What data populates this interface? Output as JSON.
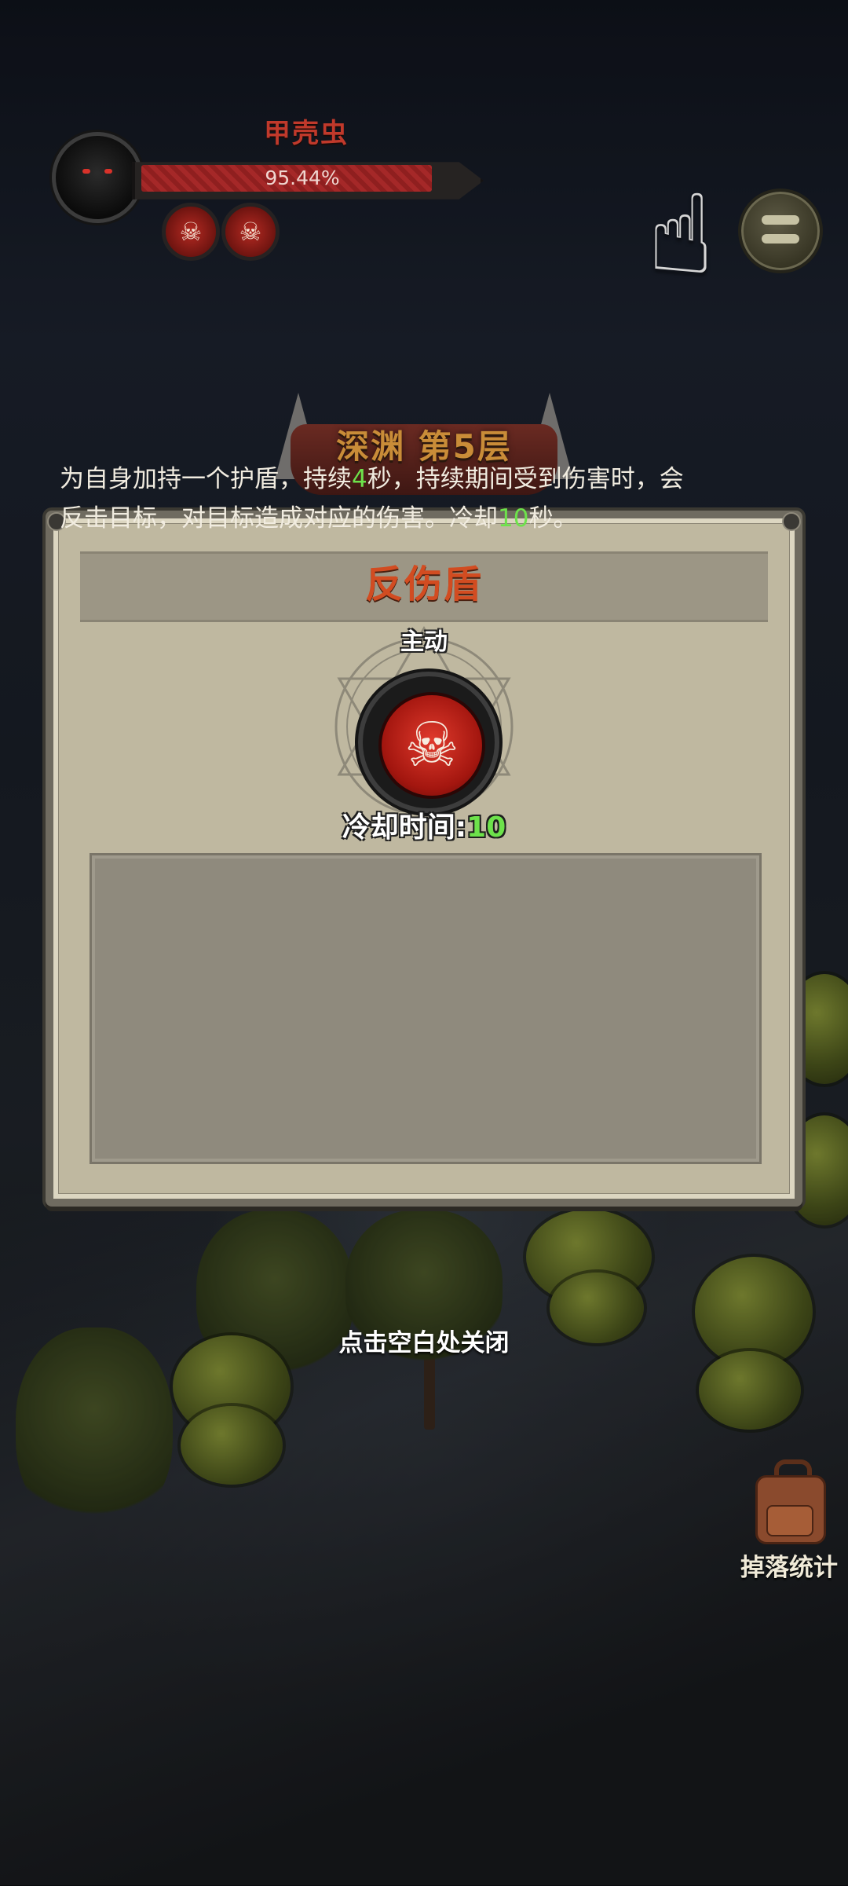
{
  "boss": {
    "name": "甲壳虫",
    "hp_percent_text": "95.44%",
    "hp_fraction": 0.9544,
    "skills": [
      "skull-icon",
      "skull-icon"
    ]
  },
  "floor": {
    "title": "深渊 第5层"
  },
  "skill_dialog": {
    "title": "反伤盾",
    "type": "主动",
    "icon": "skull-icon",
    "cooldown_label": "冷却时间:",
    "cooldown_value": "10",
    "description": {
      "part1": "为自身加持一个护盾，持续",
      "duration": "4",
      "part2": "秒，持续期间受到伤害时，会反击目标，对目标造成对应的伤害。冷却",
      "cooldown": "10",
      "part3": "秒。"
    }
  },
  "close_hint": "点击空白处关闭",
  "drop_stats_label": "掉落统计",
  "colors": {
    "title_orange": "#d24c21",
    "highlight_green": "#6de24b",
    "boss_name_red": "#c0392b",
    "hp_red": "#a52828"
  }
}
